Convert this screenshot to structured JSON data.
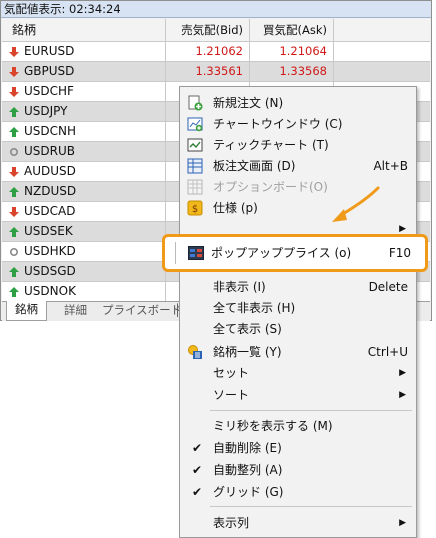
{
  "window": {
    "title": "気配値表示: 02:34:24"
  },
  "columns": {
    "symbol": "銘柄",
    "bid": "売気配(Bid)",
    "ask": "買気配(Ask)"
  },
  "rows": [
    {
      "symbol": "EURUSD",
      "bid": "1.21062",
      "ask": "1.21064",
      "dir": "down"
    },
    {
      "symbol": "GBPUSD",
      "bid": "1.33561",
      "ask": "1.33568",
      "dir": "down"
    },
    {
      "symbol": "USDCHF",
      "bid": "",
      "ask": "",
      "dir": "down"
    },
    {
      "symbol": "USDJPY",
      "bid": "",
      "ask": "",
      "dir": "up"
    },
    {
      "symbol": "USDCNH",
      "bid": "",
      "ask": "",
      "dir": "up"
    },
    {
      "symbol": "USDRUB",
      "bid": "",
      "ask": "",
      "dir": "none"
    },
    {
      "symbol": "AUDUSD",
      "bid": "",
      "ask": "",
      "dir": "down"
    },
    {
      "symbol": "NZDUSD",
      "bid": "",
      "ask": "",
      "dir": "up"
    },
    {
      "symbol": "USDCAD",
      "bid": "",
      "ask": "",
      "dir": "down"
    },
    {
      "symbol": "USDSEK",
      "bid": "",
      "ask": "",
      "dir": "up"
    },
    {
      "symbol": "USDHKD",
      "bid": "",
      "ask": "",
      "dir": "none"
    },
    {
      "symbol": "USDSGD",
      "bid": "",
      "ask": "",
      "dir": "up"
    },
    {
      "symbol": "USDNOK",
      "bid": "",
      "ask": "",
      "dir": "up"
    }
  ],
  "tabs": [
    "銘柄",
    "詳細",
    "プライスボード",
    "│"
  ],
  "menu": {
    "new_order": {
      "label": "新規注文 (N)"
    },
    "chart_window": {
      "label": "チャートウインドウ (C)"
    },
    "tick_chart": {
      "label": "ティックチャート (T)"
    },
    "board_order": {
      "label": "板注文画面 (D)",
      "shortcut": "Alt+B"
    },
    "option_board": {
      "label": "オプションボード(O)"
    },
    "spec": {
      "label": "仕様 (p)"
    },
    "hidden_partial": {
      "label": "非表示 (I)",
      "shortcut": "Delete"
    },
    "hide_all": {
      "label": "全て非表示 (H)"
    },
    "show_all": {
      "label": "全て表示 (S)"
    },
    "symbol_list": {
      "label": "銘柄一覧 (Y)",
      "shortcut": "Ctrl+U"
    },
    "set": {
      "label": "セット"
    },
    "sort": {
      "label": "ソート"
    },
    "show_ms": {
      "label": "ミリ秒を表示する (M)"
    },
    "auto_remove": {
      "label": "自動削除 (E)"
    },
    "auto_arrange": {
      "label": "自動整列 (A)"
    },
    "grid": {
      "label": "グリッド (G)"
    },
    "columns": {
      "label": "表示列"
    },
    "popup_prices": {
      "label": "ポップアッププライス (o)",
      "shortcut": "F10"
    }
  },
  "colors": {
    "down": "#d9442a",
    "up": "#2ea043",
    "highlight": "#f09a1a",
    "price": "#d01818"
  }
}
